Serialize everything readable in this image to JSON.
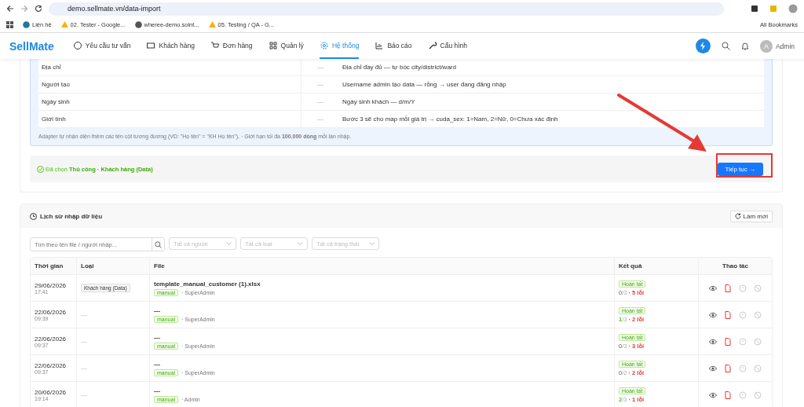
{
  "browser": {
    "url": "demo.sellmate.vn/data-import",
    "bookmarks": [
      {
        "kind": "wp",
        "label": "Liên hệ"
      },
      {
        "kind": "drive",
        "label": "02. Tester - Google..."
      },
      {
        "kind": "globe",
        "label": "wheree-demo.soint..."
      },
      {
        "kind": "drive",
        "label": "05. Testing / QA - G..."
      }
    ],
    "all_bookmarks": "All Bookmarks"
  },
  "app": {
    "logo": "SellMate",
    "nav": [
      {
        "kind": "chat",
        "label": "Yêu cầu tư vấn",
        "selected": false
      },
      {
        "kind": "card",
        "label": "Khách hàng",
        "selected": false
      },
      {
        "kind": "cart",
        "label": "Đơn hàng",
        "selected": false
      },
      {
        "kind": "grid",
        "label": "Quản lý",
        "selected": false
      },
      {
        "kind": "gear",
        "label": "Hệ thống",
        "selected": true
      },
      {
        "kind": "chart",
        "label": "Báo cáo",
        "selected": false
      },
      {
        "kind": "wrench",
        "label": "Cấu hình",
        "selected": false
      }
    ],
    "user": {
      "avatar": "A",
      "name": "Admin"
    }
  },
  "mapping": {
    "rows": [
      {
        "field": "Địa chỉ",
        "sample": "—",
        "description": "Địa chỉ đầy đủ — tự bóc city/district/ward"
      },
      {
        "field": "Người tạo",
        "sample": "—",
        "description": "Username admin tạo data — rỗng → user đang đăng nhập"
      },
      {
        "field": "Ngày sinh",
        "sample": "—",
        "description": "Ngày sinh khách — d/m/Y"
      },
      {
        "field": "Giới tính",
        "sample": "—",
        "description": "Bước 3 sẽ cho map mỗi giá trị → cuda_sex: 1=Nam, 2=Nữ, 0=Chưa xác định"
      }
    ],
    "note": "Adapter tự nhận diện thêm các tên cột tương đương (VD: \"Họ tên\" = \"KH Họ tên\"). · Giới hạn tối đa **100.000 dòng** mỗi lần nhập."
  },
  "selection": {
    "prefix": "Đã chọn",
    "value": "Thủ công · Khách hàng (Data)",
    "button": "Tiếp tục →"
  },
  "history": {
    "title": "Lịch sử nhập dữ liệu",
    "refresh": "Làm mới",
    "filters": {
      "search_placeholder": "Tìm theo tên file / người nhập...",
      "selects": [
        "Tất cả nguồn",
        "Tất cả loại",
        "Tất cả trạng thái"
      ]
    },
    "columns": [
      "Thời gian",
      "Loại",
      "File",
      "Kết quả",
      "Thao tác"
    ],
    "rows": [
      {
        "date": "29/06/2026",
        "time": "17:41",
        "type": "Khách hàng (Data)",
        "file": "template_manual_customer (1).xlsx",
        "source": "manual",
        "user": "· SuperAdmin",
        "status": "Hoàn tất",
        "ok": "0",
        "ok_positive": false,
        "total": "/3",
        "sep": "·",
        "errors": "5 lỗi"
      },
      {
        "date": "22/06/2026",
        "time": "09:39",
        "type": "—",
        "file": "—",
        "source": "manual",
        "user": "· SuperAdmin",
        "status": "Hoàn tất",
        "ok": "1",
        "ok_positive": true,
        "total": "/3",
        "sep": "·",
        "errors": "2 lỗi"
      },
      {
        "date": "22/06/2026",
        "time": "09:37",
        "type": "—",
        "file": "—",
        "source": "manual",
        "user": "· SuperAdmin",
        "status": "Hoàn tất",
        "ok": "0",
        "ok_positive": false,
        "total": "/3",
        "sep": "·",
        "errors": "3 lỗi"
      },
      {
        "date": "22/06/2026",
        "time": "09:37",
        "type": "—",
        "file": "—",
        "source": "manual",
        "user": "· SuperAdmin",
        "status": "Hoàn tất",
        "ok": "0",
        "ok_positive": false,
        "total": "/2",
        "sep": "·",
        "errors": "2 lỗi"
      },
      {
        "date": "20/06/2026",
        "time": "19:14",
        "type": "—",
        "file": "—",
        "source": "manual",
        "user": "· Admin",
        "status": "Hoàn tất",
        "ok": "2",
        "ok_positive": true,
        "total": "/3",
        "sep": "·",
        "errors": "1 lỗi"
      }
    ],
    "actions": [
      {
        "kind": "view",
        "disabled": false
      },
      {
        "kind": "file",
        "disabled": false
      },
      {
        "kind": "clock",
        "disabled": true
      },
      {
        "kind": "ban",
        "disabled": true
      }
    ]
  }
}
